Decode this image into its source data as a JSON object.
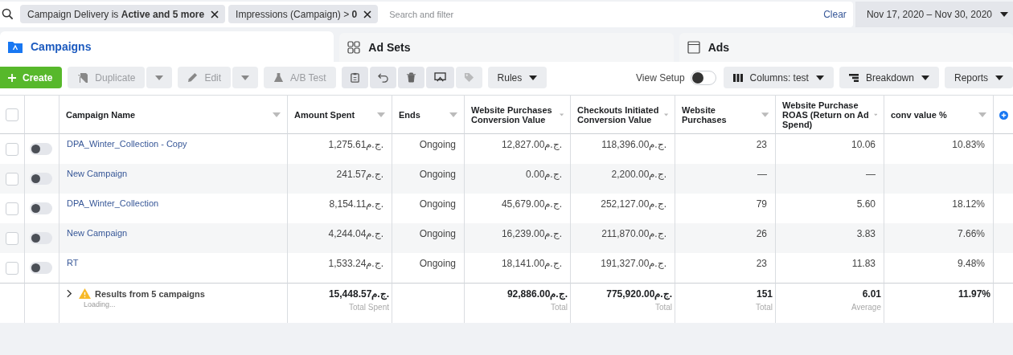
{
  "filters": [
    {
      "text": "Campaign Delivery is **Active and 5 more**"
    },
    {
      "text": "Impressions (Campaign) > **0**"
    }
  ],
  "search": {
    "placeholder": "Search and filter"
  },
  "clear": "Clear",
  "date_range": "Nov 17, 2020 – Nov 30, 2020",
  "tabs": [
    {
      "label": "Campaigns",
      "selected": true
    },
    {
      "label": "Ad Sets",
      "selected": false
    },
    {
      "label": "Ads",
      "selected": false
    }
  ],
  "toolbar": {
    "create": "Create",
    "duplicate": {
      "label": "Duplicate",
      "disabled": true
    },
    "edit": {
      "label": "Edit",
      "disabled": true
    },
    "ab_test": {
      "label": "A/B Test",
      "disabled": true
    },
    "icon_buttons": [
      {
        "kind": "clipboard",
        "disabled": false
      },
      {
        "kind": "undo",
        "disabled": false
      },
      {
        "kind": "trash",
        "disabled": false
      },
      {
        "kind": "review",
        "disabled": false
      },
      {
        "kind": "tag",
        "disabled": true
      }
    ],
    "rules": "Rules",
    "view_setup": {
      "label": "View Setup",
      "on": false
    },
    "columns": "Columns: test",
    "breakdown": "Breakdown",
    "reports": "Reports"
  },
  "table": {
    "select_all_checked": false,
    "columns": [
      "Campaign Name",
      "Amount Spent",
      "Ends",
      "Website Purchases Conversion Value",
      "Checkouts Initiated Conversion Value",
      "Website Purchases",
      "Website Purchase ROAS (Return on Ad Spend)",
      "conv value %"
    ],
    "rows": [
      {
        "checked": false,
        "on": false,
        "cells": [
          "DPA_Winter_Collection - Copy",
          "1,275.61ج.م.",
          "Ongoing",
          "12,827.00ج.م.",
          "118,396.00ج.م.",
          "23",
          "10.06",
          "10.83%"
        ]
      },
      {
        "checked": false,
        "on": false,
        "cells": [
          "New Campaign",
          "241.57ج.م.",
          "Ongoing",
          "0.00ج.م.",
          "2,200.00ج.م.",
          "—",
          "—",
          null
        ]
      },
      {
        "checked": false,
        "on": false,
        "cells": [
          "DPA_Winter_Collection",
          "8,154.11ج.م.",
          "Ongoing",
          "45,679.00ج.م.",
          "252,127.00ج.م.",
          "79",
          "5.60",
          "18.12%"
        ]
      },
      {
        "checked": false,
        "on": false,
        "cells": [
          "New Campaign",
          "4,244.04ج.م.",
          "Ongoing",
          "16,239.00ج.م.",
          "211,870.00ج.م.",
          "26",
          "3.83",
          "7.66%"
        ]
      },
      {
        "checked": false,
        "on": false,
        "cells": [
          "RT",
          "1,533.24ج.م.",
          "Ongoing",
          "18,141.00ج.م.",
          "191,327.00ج.م.",
          "23",
          "11.83",
          "9.48%"
        ]
      }
    ],
    "summary": {
      "title": "Results from 5 campaigns",
      "status": "Loading...",
      "cells": [
        {
          "value": "15,448.57ج.م.",
          "label": "Total Spent"
        },
        null,
        {
          "value": "92,886.00ج.م.",
          "label": "Total"
        },
        {
          "value": "775,920.00ج.م.",
          "label": "Total"
        },
        {
          "value": "151",
          "label": "Total"
        },
        {
          "value": "6.01",
          "label": "Average"
        },
        {
          "value": "11.97%"
        }
      ]
    }
  }
}
